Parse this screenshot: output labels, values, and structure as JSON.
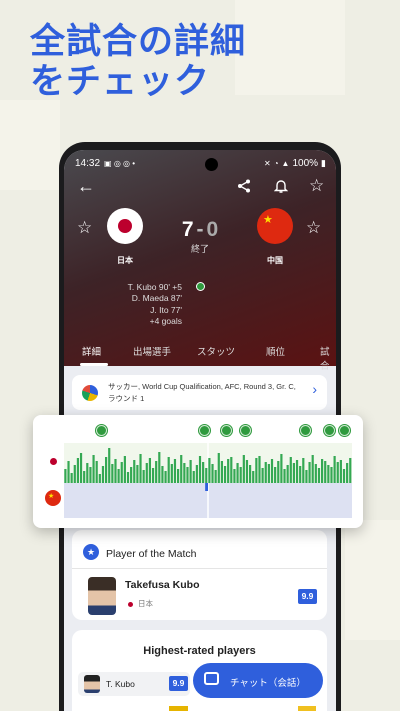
{
  "headline": {
    "line1": "全試合の詳細",
    "line2": "をチェック"
  },
  "status_bar": {
    "time": "14:32",
    "battery": "100%"
  },
  "header": {
    "back_icon": "arrow-left-icon",
    "share_icon": "share-icon",
    "bell_icon": "bell-icon",
    "star_icon": "star-icon"
  },
  "match": {
    "home_score": "7",
    "separator": "-",
    "away_score": "0",
    "status": "終了",
    "home_team": "日本",
    "away_team": "中国",
    "scorers": [
      "T. Kubo 90' +5",
      "D. Maeda 87'",
      "J. Ito 77'",
      "+4 goals"
    ]
  },
  "tabs": [
    "詳細",
    "出場選手",
    "スタッツ",
    "順位",
    "試合"
  ],
  "competition": {
    "text": "サッカー, World Cup Qualification, AFC, Round 3, Gr. C, ラウンド 1"
  },
  "momentum": {
    "home": [
      14,
      22,
      10,
      18,
      25,
      30,
      12,
      20,
      16,
      28,
      22,
      9,
      17,
      26,
      35,
      19,
      24,
      14,
      21,
      27,
      11,
      16,
      23,
      18,
      29,
      13,
      20,
      25,
      15,
      22,
      31,
      17,
      12,
      26,
      19,
      24,
      14,
      28,
      20,
      16,
      23,
      12,
      18,
      27,
      21,
      15,
      25,
      19,
      13,
      30,
      22,
      17,
      24,
      26,
      14,
      20,
      16,
      28,
      23,
      18,
      12,
      25,
      27,
      15,
      21,
      19,
      24,
      16,
      22,
      29,
      14,
      18,
      26,
      20,
      23,
      17,
      25,
      13,
      21,
      28,
      19,
      15,
      24,
      22,
      18,
      16,
      27,
      21,
      23,
      14,
      20,
      25
    ],
    "away": [
      0,
      0,
      0,
      0,
      0,
      0,
      0,
      0,
      0,
      0,
      0,
      0,
      0,
      0,
      0,
      0,
      0,
      0,
      0,
      0,
      0,
      0,
      0,
      0,
      0,
      0,
      0,
      0,
      0,
      0,
      0,
      0,
      0,
      0,
      0,
      0,
      0,
      0,
      0,
      0,
      0,
      0,
      0,
      0,
      0,
      8,
      0,
      0,
      0,
      0,
      0,
      0,
      0,
      0,
      0,
      0,
      0,
      0,
      0,
      0,
      0,
      0,
      0,
      0,
      0,
      0,
      0,
      0,
      0,
      0,
      0,
      0,
      0,
      0,
      0,
      0,
      0,
      0,
      0,
      0,
      0,
      0,
      0,
      0,
      0,
      0,
      0,
      0,
      0,
      0,
      0,
      0,
      0,
      0,
      0,
      0
    ]
  },
  "potm": {
    "title": "Player of the Match",
    "name": "Takefusa Kubo",
    "country": "日本",
    "rating": "9.9"
  },
  "highest_rated": {
    "title": "Highest-rated players",
    "players": [
      {
        "name": "T. Kubo",
        "rating": "9.9"
      }
    ]
  },
  "chat": {
    "label": "チャット（会話）"
  }
}
